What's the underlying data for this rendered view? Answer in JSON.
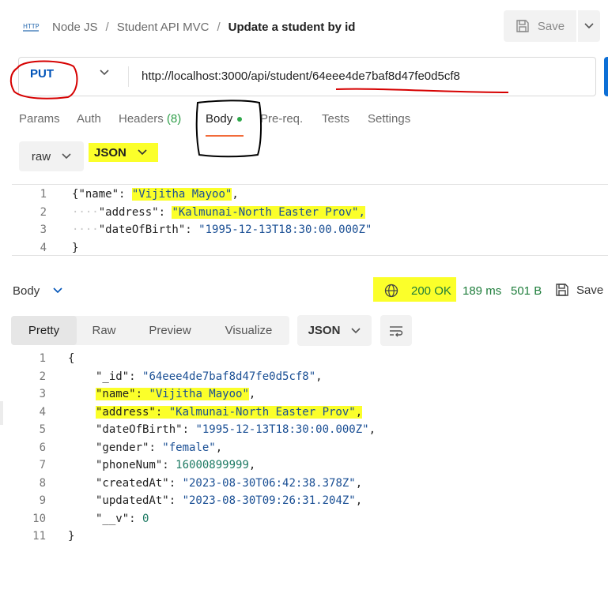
{
  "breadcrumb": {
    "collection": "Node JS",
    "folder": "Student API MVC",
    "request_name": "Update a student by id",
    "separator": "/"
  },
  "toolbar": {
    "save_label": "Save"
  },
  "request": {
    "method": "PUT",
    "url": "http://localhost:3000/api/student/64eee4de7baf8d47fe0d5cf8"
  },
  "request_tabs": {
    "params": "Params",
    "auth": "Auth",
    "headers": "Headers",
    "headers_count": "(8)",
    "body": "Body",
    "prereq": "Pre-req.",
    "tests": "Tests",
    "settings": "Settings"
  },
  "body_mode": {
    "type": "raw",
    "language": "JSON"
  },
  "request_body": {
    "line_numbers": [
      "1",
      "2",
      "3",
      "4"
    ],
    "open_brace": "{",
    "close_brace": "}",
    "key1": "\"name\"",
    "val1": "\"Vijitha Mayoo\"",
    "key2": "\"address\"",
    "val2": "\"Kalmunai-North Easter Prov\"",
    "key3": "\"dateOfBirth\"",
    "val3": "\"1995-12-13T18:30:00.000Z\""
  },
  "response": {
    "label": "Body",
    "status": "200 OK",
    "time": "189 ms",
    "size": "501 B",
    "save_label": "Save",
    "view_tabs": [
      "Pretty",
      "Raw",
      "Preview",
      "Visualize"
    ],
    "format": "JSON"
  },
  "response_body": {
    "line_numbers": [
      "1",
      "2",
      "3",
      "4",
      "5",
      "6",
      "7",
      "8",
      "9",
      "10",
      "11"
    ],
    "open_brace": "{",
    "close_brace": "}",
    "fields": [
      {
        "key": "\"_id\"",
        "value": "\"64eee4de7baf8d47fe0d5cf8\""
      },
      {
        "key": "\"name\"",
        "value": "\"Vijitha Mayoo\""
      },
      {
        "key": "\"address\"",
        "value": "\"Kalmunai-North Easter Prov\""
      },
      {
        "key": "\"dateOfBirth\"",
        "value": "\"1995-12-13T18:30:00.000Z\""
      },
      {
        "key": "\"gender\"",
        "value": "\"female\""
      },
      {
        "key": "\"phoneNum\"",
        "value": "16000899999"
      },
      {
        "key": "\"createdAt\"",
        "value": "\"2023-08-30T06:42:38.378Z\""
      },
      {
        "key": "\"updatedAt\"",
        "value": "\"2023-08-30T09:26:31.204Z\""
      },
      {
        "key": "\"__v\"",
        "value": "0"
      }
    ]
  },
  "colors": {
    "method": "#0053b8",
    "tab_underline": "#f26b3a",
    "status_ok": "#1e7d3b",
    "highlight": "#fbff2a",
    "annotation_red": "#d60000"
  }
}
